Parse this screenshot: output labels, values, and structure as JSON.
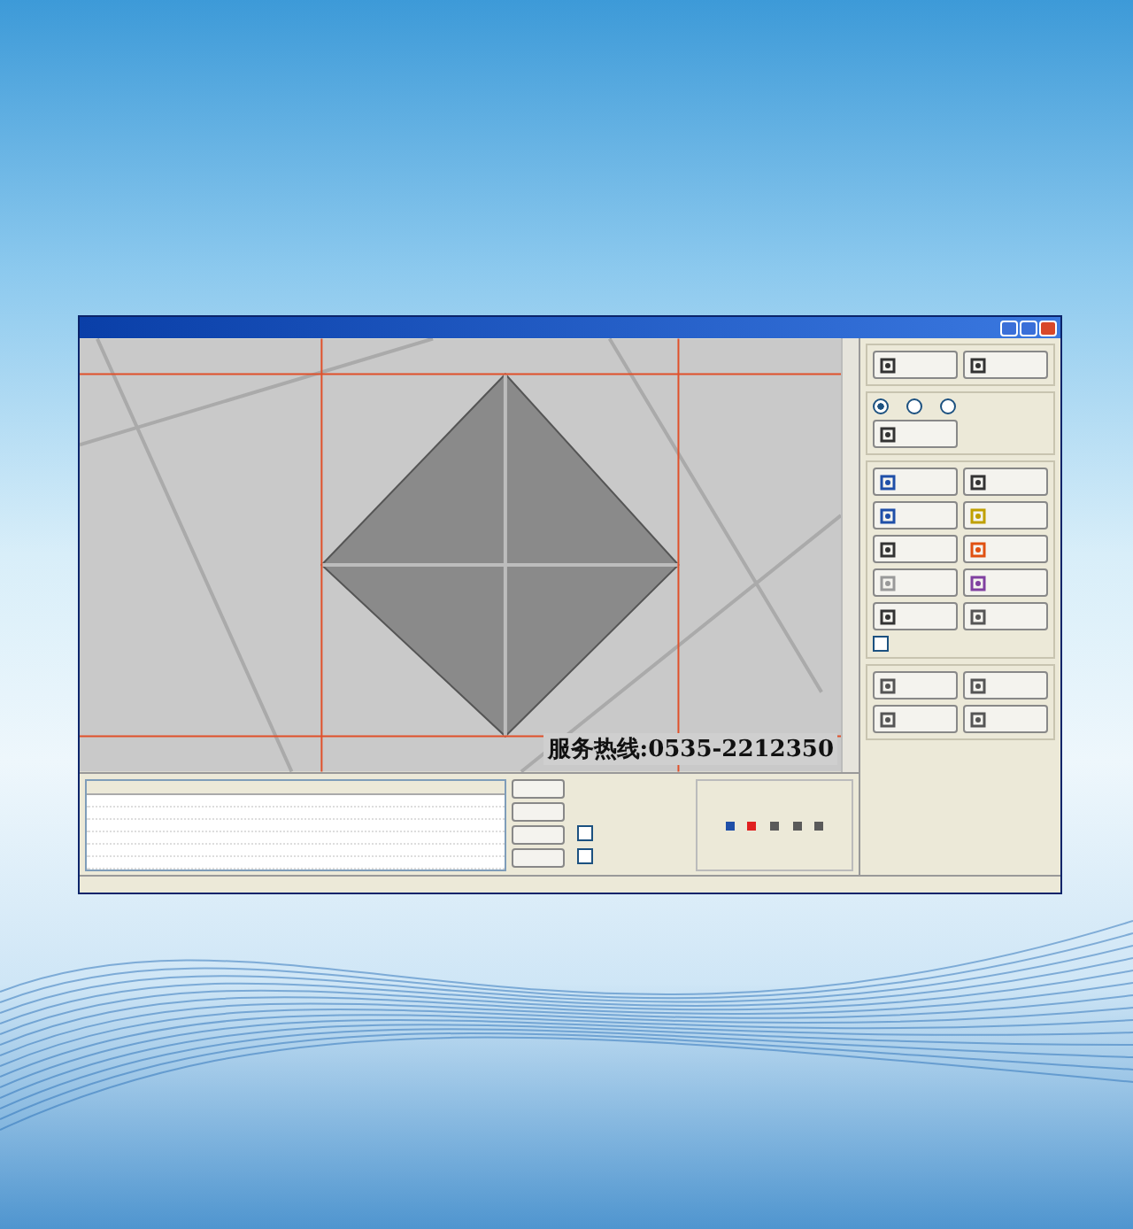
{
  "window": {
    "hotline": "服务热线:0535-2212350"
  },
  "modes": [
    {
      "selected": true
    },
    {
      "selected": false
    },
    {
      "selected": false
    }
  ],
  "show_center": {
    "checked": false
  },
  "options": [
    {
      "checked": false
    },
    {
      "checked": false
    }
  ],
  "markers": [
    {
      "color": "#1f4fa8"
    },
    {
      "color": "#e02020"
    },
    {
      "color": "#5a5a5a"
    },
    {
      "color": "#5a5a5a"
    },
    {
      "color": "#5a5a5a"
    }
  ]
}
